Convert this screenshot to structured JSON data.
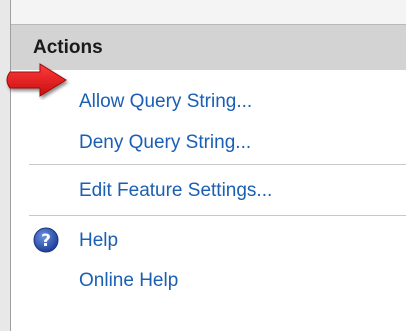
{
  "panel": {
    "title": "Actions"
  },
  "actions": {
    "allow_query": "Allow Query String...",
    "deny_query": "Deny Query String...",
    "edit_feature": "Edit Feature Settings...",
    "help": "Help",
    "online_help": "Online Help"
  },
  "colors": {
    "link": "#1a5fb4",
    "header_bg": "#d3d3d3",
    "arrow": "#e41c1c",
    "help_icon": "#2b57b6"
  },
  "icons": {
    "help": "help-circle-icon",
    "pointer": "red-arrow-icon"
  }
}
